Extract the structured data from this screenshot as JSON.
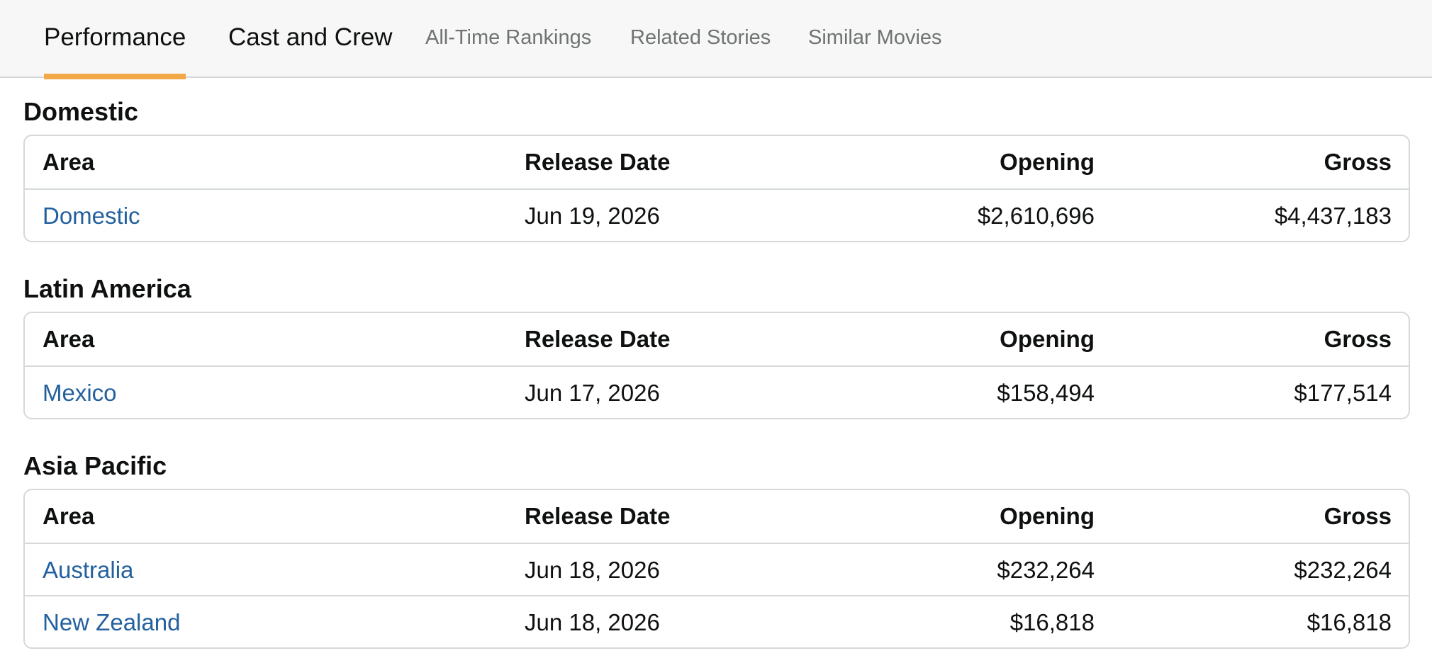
{
  "tabs": [
    {
      "label": "Performance",
      "active": true
    },
    {
      "label": "Cast and Crew"
    },
    {
      "label": "All-Time Rankings"
    },
    {
      "label": "Related Stories"
    },
    {
      "label": "Similar Movies"
    }
  ],
  "columns": {
    "area": "Area",
    "release_date": "Release Date",
    "opening": "Opening",
    "gross": "Gross"
  },
  "sections": [
    {
      "title": "Domestic",
      "rows": [
        {
          "area": "Domestic",
          "release_date": "Jun 19, 2026",
          "opening": "$2,610,696",
          "gross": "$4,437,183"
        }
      ]
    },
    {
      "title": "Latin America",
      "rows": [
        {
          "area": "Mexico",
          "release_date": "Jun 17, 2026",
          "opening": "$158,494",
          "gross": "$177,514"
        }
      ]
    },
    {
      "title": "Asia Pacific",
      "rows": [
        {
          "area": "Australia",
          "release_date": "Jun 18, 2026",
          "opening": "$232,264",
          "gross": "$232,264"
        },
        {
          "area": "New Zealand",
          "release_date": "Jun 18, 2026",
          "opening": "$16,818",
          "gross": "$16,818"
        }
      ]
    }
  ],
  "colors": {
    "accent_underline": "#f3a847",
    "link": "#23609e",
    "border": "#d5d9d9",
    "tabbar_bg": "#f7f7f7"
  }
}
